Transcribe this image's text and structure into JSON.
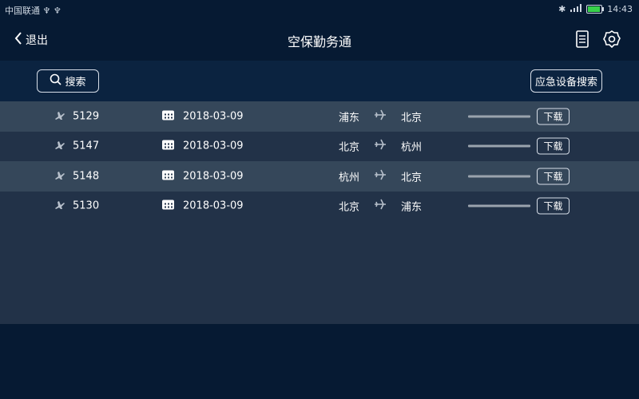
{
  "status_bar": {
    "carrier": "中国联通 ♆ ♆",
    "time": "14:43"
  },
  "header": {
    "back_label": "退出",
    "title": "空保勤务通"
  },
  "toolbar": {
    "search_label": "搜索",
    "emergency_search_label": "应急设备搜索"
  },
  "flights": [
    {
      "flight": "5129",
      "date": "2018-03-09",
      "from": "浦东",
      "to": "北京",
      "download_label": "下载",
      "progress": 0
    },
    {
      "flight": "5147",
      "date": "2018-03-09",
      "from": "北京",
      "to": "杭州",
      "download_label": "下载",
      "progress": 0
    },
    {
      "flight": "5148",
      "date": "2018-03-09",
      "from": "杭州",
      "to": "北京",
      "download_label": "下载",
      "progress": 0
    },
    {
      "flight": "5130",
      "date": "2018-03-09",
      "from": "北京",
      "to": "浦东",
      "download_label": "下载",
      "progress": 0
    }
  ],
  "colors": {
    "background": "#061a33",
    "toolbar": "#0b2340",
    "list_bg": "#223248",
    "row_alt": "#35475a",
    "battery": "#38d14a"
  }
}
